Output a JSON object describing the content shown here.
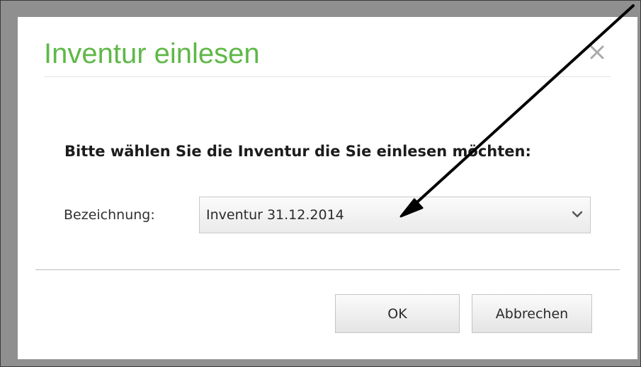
{
  "dialog": {
    "title": "Inventur einlesen",
    "close_icon": "close-icon",
    "prompt": "Bitte wählen Sie die Inventur die Sie einlesen möchten:",
    "field": {
      "label": "Bezeichnung:",
      "selected_value": "Inventur 31.12.2014",
      "dropdown_icon": "chevron-down-icon"
    },
    "buttons": {
      "ok_label": "OK",
      "cancel_label": "Abbrechen"
    }
  },
  "annotation": {
    "type": "arrow",
    "color": "#000000"
  },
  "colors": {
    "title": "#5fb847",
    "frame": "#8f8f8f",
    "dialog_background": "#ffffff",
    "text": "#1c1c1c"
  }
}
